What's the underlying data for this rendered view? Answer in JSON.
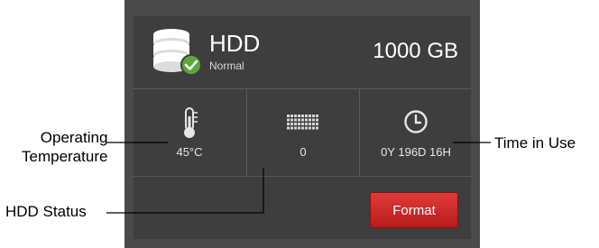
{
  "hdd": {
    "title": "HDD",
    "state": "Normal",
    "capacity": "1000 GB"
  },
  "stats": {
    "temperature": {
      "icon": "thermometer-icon",
      "value": "45°C"
    },
    "status": {
      "icon": "disk-grid-icon",
      "value": "0"
    },
    "time_in_use": {
      "icon": "clock-icon",
      "value": "0Y 196D 16H"
    }
  },
  "actions": {
    "format_label": "Format"
  },
  "callouts": {
    "operating_temperature": [
      "Operating",
      "Temperature"
    ],
    "hdd_status": "HDD Status",
    "time_in_use": "Time in Use"
  },
  "colors": {
    "panel": "#4a4a4a",
    "cell": "#3e3e3e",
    "format_button": "#cc2a2a",
    "ok_badge": "#5aa83a"
  }
}
